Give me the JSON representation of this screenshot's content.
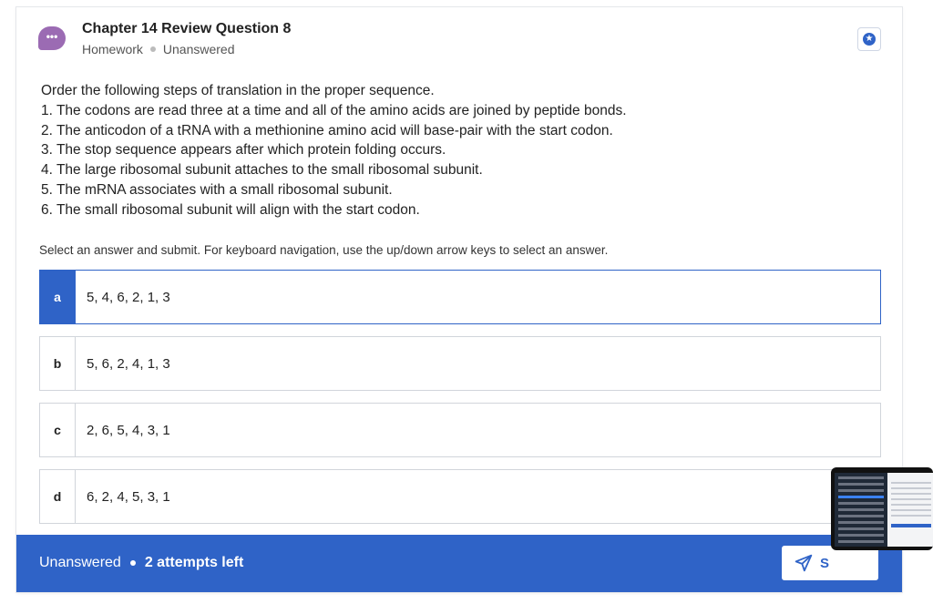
{
  "header": {
    "avatar_glyph": "•••",
    "title": "Chapter 14 Review Question 8",
    "category": "Homework",
    "status": "Unanswered",
    "icons": [
      "chat-bubble-icon",
      "star-icon"
    ]
  },
  "question": {
    "prompt": "Order the following steps of translation in the proper sequence.",
    "steps": [
      "1. The codons are read three at a time and all of the amino acids are joined by peptide bonds.",
      "2. The anticodon of a tRNA with a methionine amino acid will base-pair with the start codon.",
      "3. The stop sequence appears after which protein folding occurs.",
      "4. The large ribosomal subunit attaches to the small ribosomal subunit.",
      "5. The mRNA associates with a small ribosomal subunit.",
      "6. The small ribosomal subunit will align with the start codon."
    ]
  },
  "instruction": "Select an answer and submit. For keyboard navigation, use the up/down arrow keys to select an answer.",
  "options": [
    {
      "letter": "a",
      "text": "5, 4, 6, 2, 1, 3",
      "selected": true
    },
    {
      "letter": "b",
      "text": "5, 6, 2, 4, 1, 3",
      "selected": false
    },
    {
      "letter": "c",
      "text": "2, 6, 5, 4, 3, 1",
      "selected": false
    },
    {
      "letter": "d",
      "text": "6, 2, 4, 5, 3, 1",
      "selected": false
    }
  ],
  "footer": {
    "status": "Unanswered",
    "attempts": "2 attempts left",
    "submit_label": "S"
  },
  "colors": {
    "accent": "#2f63c7",
    "avatar": "#9b6bb3"
  }
}
